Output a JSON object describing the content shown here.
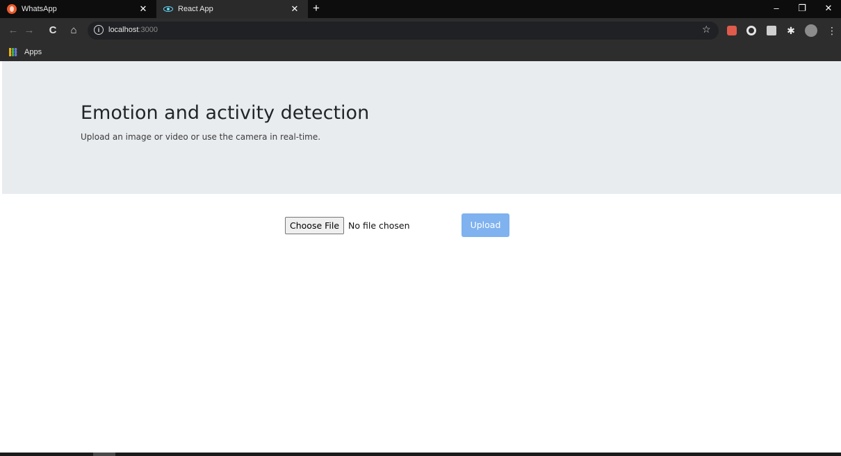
{
  "browser": {
    "tabs": [
      {
        "title": "WhatsApp",
        "icon": "whatsapp-favicon",
        "close": "✕",
        "active": false
      },
      {
        "title": "React App",
        "icon": "react-favicon",
        "close": "✕",
        "active": true
      }
    ],
    "new_tab": "+",
    "window_controls": {
      "minimize": "–",
      "restore": "❐",
      "close": "✕"
    },
    "nav": {
      "back": "←",
      "forward": "→",
      "reload": "C",
      "home": "⌂"
    },
    "address": {
      "info_icon": "i",
      "host": "localhost",
      "port": ":3000",
      "bookmark_star": "☆"
    },
    "extension_icons": [
      "shopping-extension-icon",
      "circle-extension-icon",
      "camera-extension-icon",
      "puzzle-extensions-icon",
      "profile-avatar-icon",
      "menu-dots-icon"
    ],
    "bookmarks": {
      "apps_label": "Apps"
    }
  },
  "jumbotron": {
    "title": "Emotion and activity detection",
    "lead": "Upload an image or video or use the camera in real-time."
  },
  "uploader": {
    "choose_file_label": "Choose File",
    "file_status": "No file chosen",
    "upload_label": "Upload"
  },
  "colors": {
    "jumbotron_bg": "#e9ecef",
    "upload_button": "#7fb2ef",
    "chrome_dark": "#2d2d2d"
  }
}
